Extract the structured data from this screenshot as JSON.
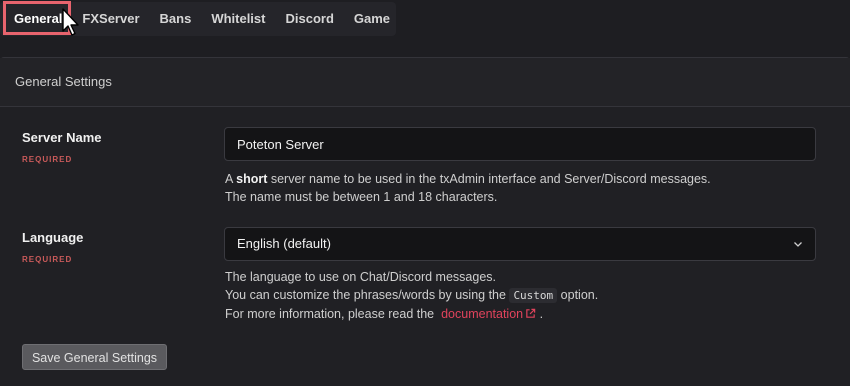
{
  "tabs": [
    {
      "label": "General",
      "active": true
    },
    {
      "label": "FXServer"
    },
    {
      "label": "Bans"
    },
    {
      "label": "Whitelist"
    },
    {
      "label": "Discord"
    },
    {
      "label": "Game"
    }
  ],
  "card": {
    "title": "General Settings"
  },
  "server_name": {
    "label": "Server Name",
    "required": "REQUIRED",
    "value": "Poteton Server",
    "help_prefix": "A ",
    "help_bold": "short",
    "help_line1_rest": " server name to be used in the txAdmin interface and Server/Discord messages.",
    "help_line2": "The name must be between 1 and 18 characters."
  },
  "language": {
    "label": "Language",
    "required": "REQUIRED",
    "selected": "English (default)",
    "help_line1": "The language to use on Chat/Discord messages.",
    "help_line2_prefix": "You can customize the phrases/words by using the",
    "help_line2_code": "Custom",
    "help_line2_suffix": "option.",
    "help_line3_prefix": "For more information, please read the",
    "help_link": "documentation",
    "help_line3_suffix": "."
  },
  "save_button": "Save General Settings",
  "colors": {
    "accent_link": "#e0435c",
    "required": "#c95a5a",
    "highlight": "#e8646e"
  }
}
